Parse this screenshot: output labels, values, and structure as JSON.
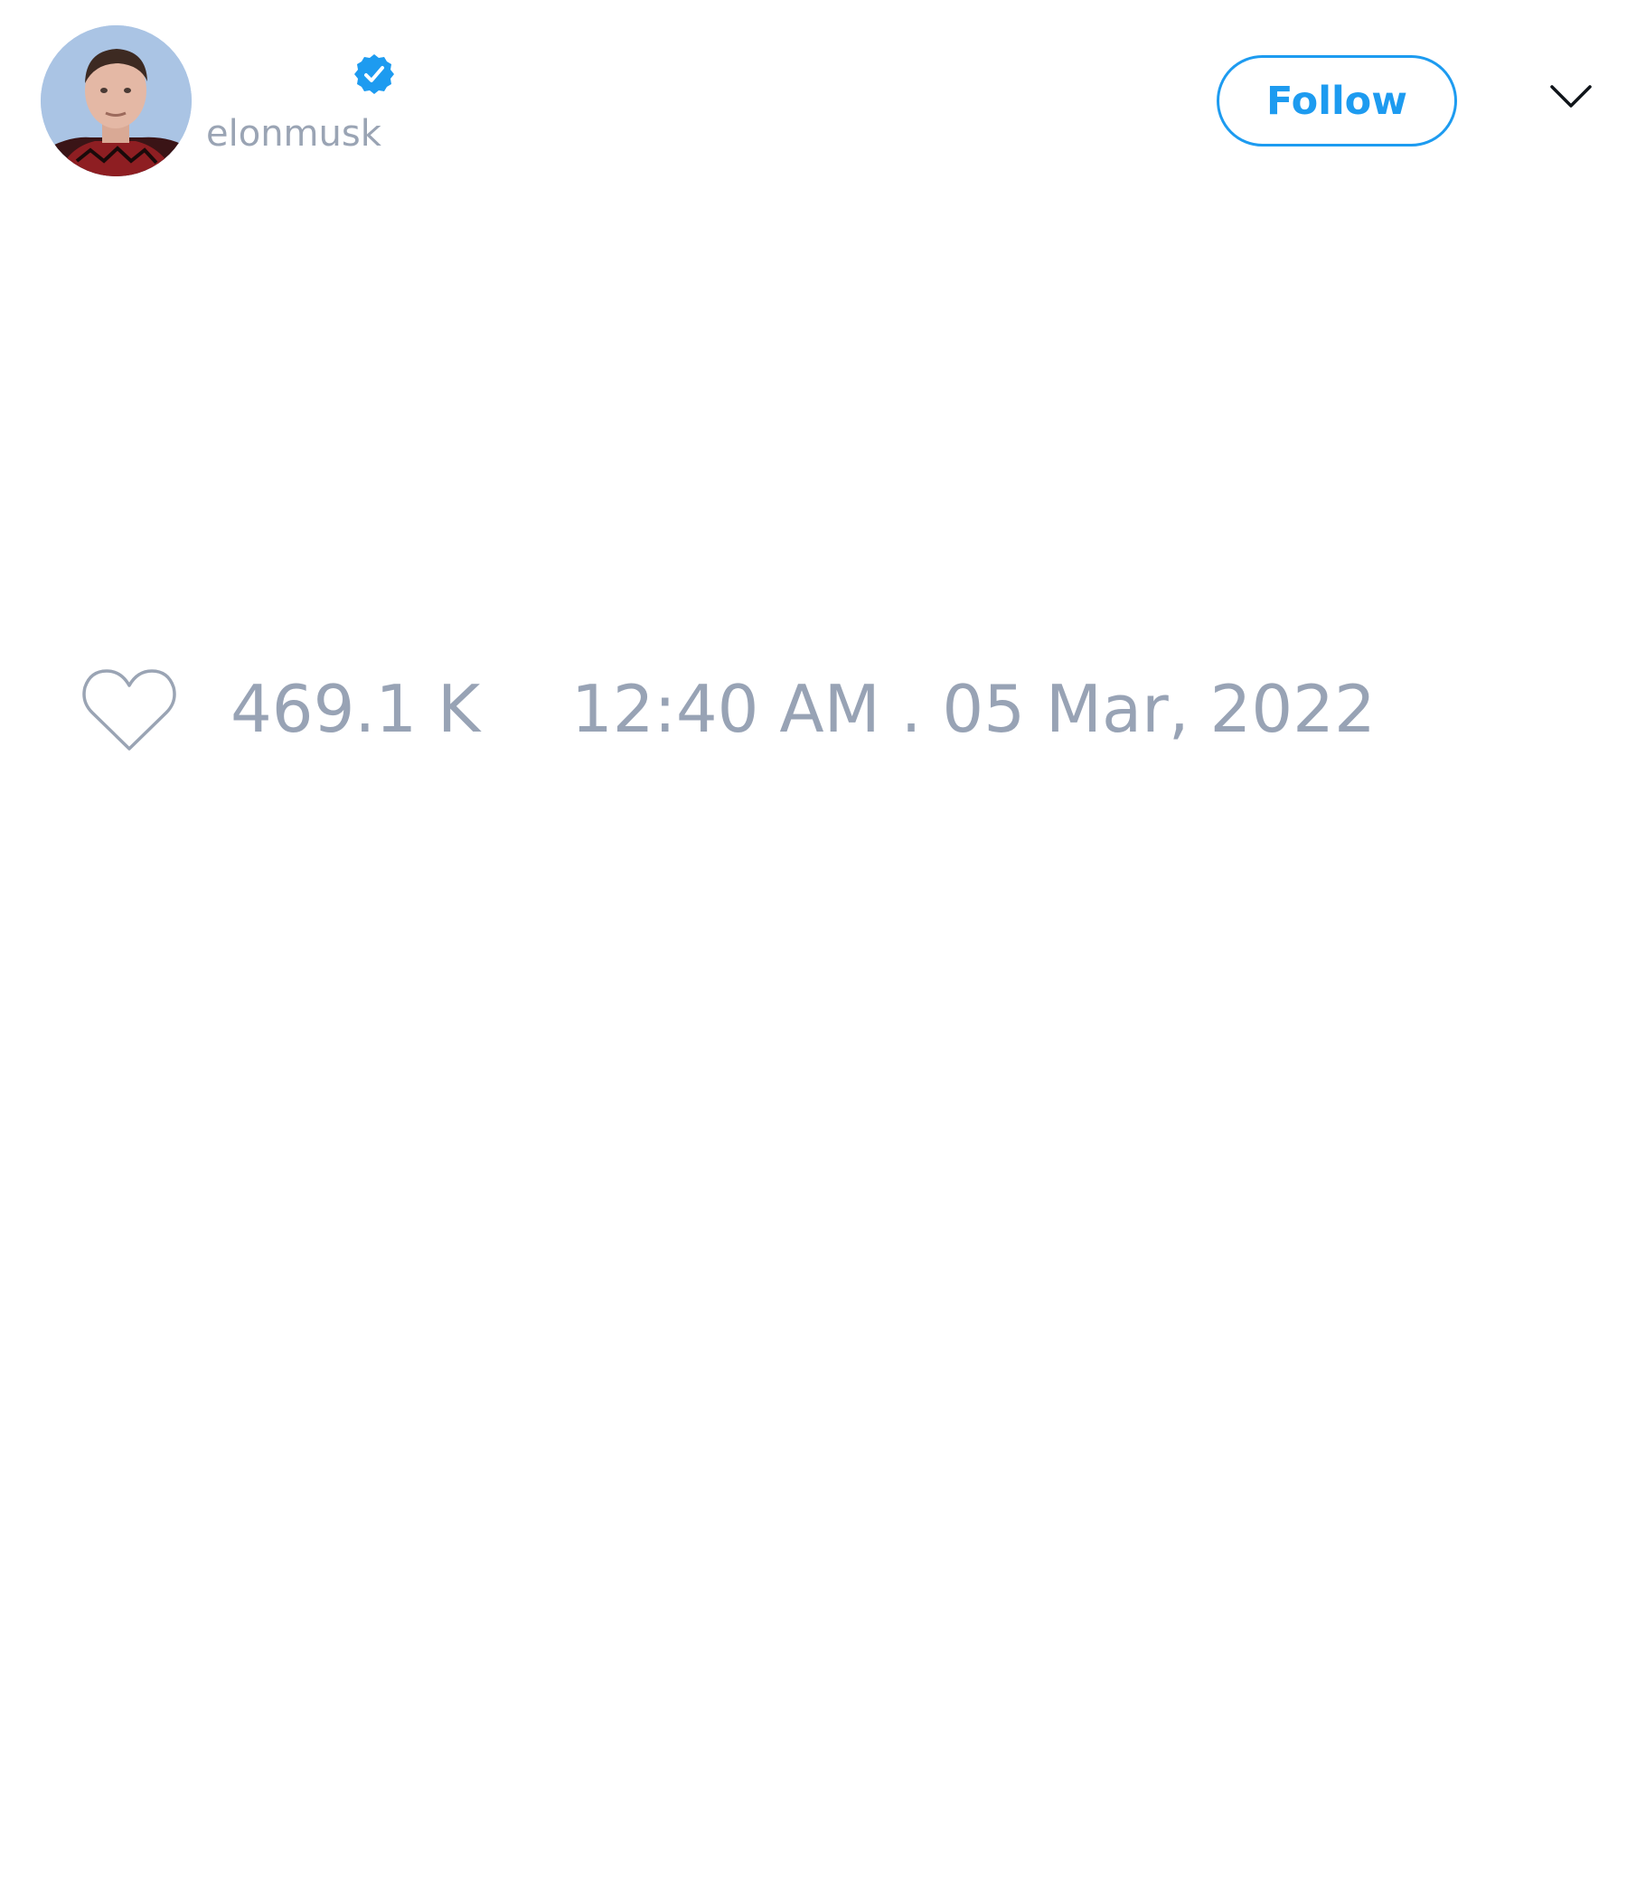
{
  "author": {
    "display_name": "",
    "handle": "elonmusk",
    "verified": true,
    "avatar_icon": "profile-photo-avatar"
  },
  "header": {
    "follow_label": "Follow",
    "menu_icon": "chevron-down-icon"
  },
  "tweet": {
    "like_icon": "heart-outline-icon",
    "like_count": "469.1 K",
    "timestamp": "12:40 AM . 05 Mar, 2022"
  },
  "colors": {
    "accent": "#1d9bf0",
    "muted_text": "#98a3b5",
    "background": "#ffffff"
  }
}
